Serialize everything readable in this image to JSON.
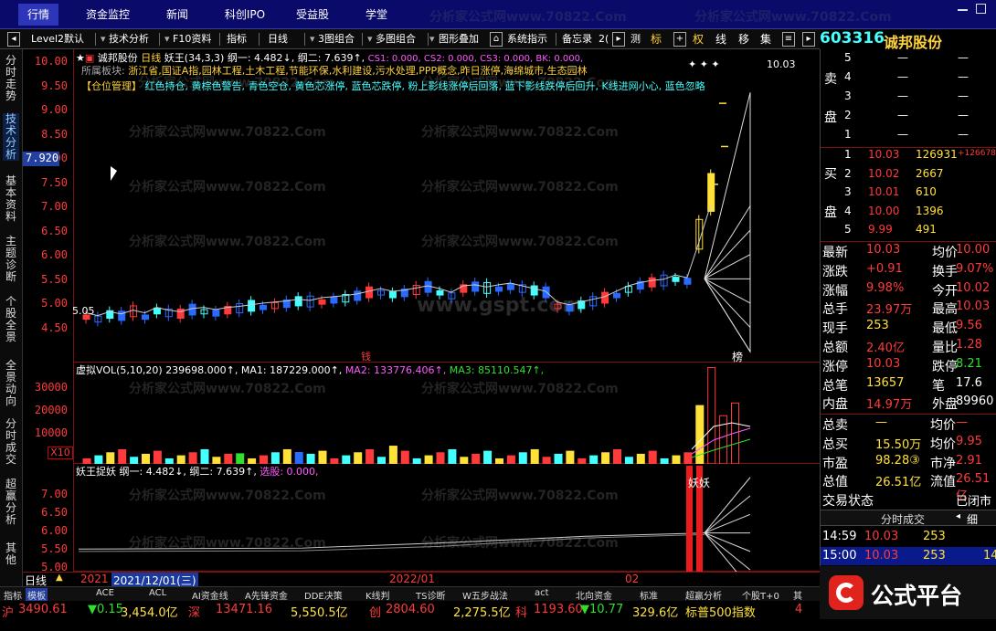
{
  "top_tabs": [
    "行情",
    "资金监控",
    "新闻",
    "科创IPO",
    "受益股",
    "学堂"
  ],
  "toolbar": {
    "items": [
      "Level2默认",
      "技术分析",
      "F10资料",
      "指标",
      "日线",
      "3图组合",
      "多图组合",
      "图形叠加",
      "系统指示",
      "备忘录"
    ],
    "right_items": [
      "测",
      "标",
      "⊞",
      "权",
      "线",
      "移",
      "集"
    ],
    "page_tail": "2("
  },
  "stock": {
    "code": "603316",
    "name": "诚邦股份"
  },
  "side_tabs": [
    "分时走势",
    "技术分析",
    "基本资料",
    "主题诊断",
    "个股全景",
    "全景动向",
    "分时成交",
    "超赢分析",
    "其他"
  ],
  "crosshair_value": "7.920",
  "main_chart": {
    "title": "诚邦股份",
    "period": "日线",
    "ind_name": "妖王(34,3,3)",
    "ind_vals": "纲一: 4.482↓, 纲二: 7.639↑,",
    "cs": "CS1: 0.000,  CS2: 0.000,  CS3: 0.000,  BK: 0.000,",
    "sector_label": "所属板块:",
    "sectors": "浙江省,国证A指,园林工程,土木工程,节能环保,水利建设,污水处理,PPP概念,昨日涨停,海绵城市,生态园林",
    "position_label": "【仓位管理】",
    "position_text": "红色持仓, 黄棕色警告, 青色空仓, 黄色芯涨停, 蓝色芯跌停, 粉上影线涨停后回落, 蓝下影线跌停后回升, K线进网小心, 蓝色忽略",
    "yticks": [
      "10.00",
      "9.50",
      "9.00",
      "8.50",
      "8.00",
      "7.50",
      "7.00",
      "6.50",
      "6.00",
      "5.50",
      "5.00",
      "4.50"
    ],
    "low_label": "5.05",
    "high_label": "10.03",
    "mark_top": "✦ ✦ ✦",
    "mark_bang": "榜",
    "mark_qian": "钱"
  },
  "vol_chart": {
    "title": "虚拟VOL(5,10,20)",
    "v": "239698.000↑,",
    "ma1": "MA1: 187229.000↑,",
    "ma2": "MA2: 133776.406↑,",
    "ma3": "MA3: 85110.547↑,",
    "yticks": [
      "30000",
      "20000",
      "10000"
    ],
    "unit": "X10"
  },
  "ind_chart": {
    "title": "妖王捉妖",
    "v1": "纲一: 4.482↓,",
    "v2": "纲二: 7.639↑,",
    "v3": "选股: 0.000,",
    "yticks": [
      "7.00",
      "6.50",
      "6.00",
      "5.50",
      "5.00"
    ],
    "signal": "妖妖"
  },
  "date_axis": {
    "period": "日线",
    "labels": [
      "2021",
      "2021/12/01(三)",
      "2022/01",
      "02"
    ]
  },
  "watermarks": [
    "分析家公式网www.70822.Com",
    "www.gspt.com"
  ],
  "bottom_nav": [
    "指标",
    "模板",
    "ACE",
    "ACL",
    "AI资金线",
    "A先锋资金",
    "DDE决策",
    "K线判",
    "TS诊断",
    "W五步战法",
    "act",
    "北向资金",
    "标准",
    "超赢分析",
    "个股T+0",
    "其"
  ],
  "ticker": [
    {
      "label": "沪",
      "v": "3490.61",
      "c": "▼0.15",
      "a": "3,454.0亿"
    },
    {
      "label": "深",
      "v": "13471.16",
      "c": "",
      "a": "5,550.5亿"
    },
    {
      "label": "创",
      "v": "2804.60",
      "c": "",
      "a": "2,275.5亿"
    },
    {
      "label": "科",
      "v": "1193.60",
      "c": "▼10.77",
      "a": "329.6亿"
    },
    {
      "label": "标普500指数",
      "v": "4"
    }
  ],
  "order_book": {
    "sell_label": [
      "卖",
      "盘"
    ],
    "buy_label": [
      "买",
      "盘"
    ],
    "sells": [
      {
        "lvl": "5",
        "p": "—",
        "v": "—"
      },
      {
        "lvl": "4",
        "p": "—",
        "v": "—"
      },
      {
        "lvl": "3",
        "p": "—",
        "v": "—"
      },
      {
        "lvl": "2",
        "p": "—",
        "v": "—"
      },
      {
        "lvl": "1",
        "p": "—",
        "v": "—"
      }
    ],
    "buys": [
      {
        "lvl": "1",
        "p": "10.03",
        "v": "126931",
        "d": "+126678"
      },
      {
        "lvl": "2",
        "p": "10.02",
        "v": "2667"
      },
      {
        "lvl": "3",
        "p": "10.01",
        "v": "610"
      },
      {
        "lvl": "4",
        "p": "10.00",
        "v": "1396"
      },
      {
        "lvl": "5",
        "p": "9.99",
        "v": "491"
      }
    ]
  },
  "quote": [
    [
      "最新",
      "10.03",
      "均价",
      "10.00"
    ],
    [
      "涨跌",
      "+0.91",
      "换手",
      "9.07%"
    ],
    [
      "涨幅",
      "9.98%",
      "今开",
      "10.02"
    ],
    [
      "总手",
      "23.97万",
      "最高",
      "10.03"
    ],
    [
      "现手",
      "253",
      "最低",
      "9.56"
    ],
    [
      "总额",
      "2.40亿",
      "量比",
      "1.28"
    ],
    [
      "涨停",
      "10.03",
      "跌停",
      "8.21"
    ],
    [
      "总笔",
      "13657",
      "笔",
      "17.6"
    ],
    [
      "内盘",
      "14.97万",
      "外盘",
      "89960"
    ]
  ],
  "quote2": [
    [
      "总卖",
      "—",
      "均价",
      "—"
    ],
    [
      "总买",
      "15.50万",
      "均价",
      "9.95"
    ],
    [
      "市盈",
      "98.28③",
      "市净",
      "2.91"
    ],
    [
      "总值",
      "26.51亿",
      "流值",
      "26.51亿"
    ],
    [
      "交易状态",
      "",
      "",
      "已闭市"
    ]
  ],
  "ticks_title": "分时成交",
  "ticks_btn": "细",
  "ticks": [
    {
      "t": "14:59",
      "p": "10.03",
      "v": "253"
    },
    {
      "t": "15:00",
      "p": "10.03",
      "v": "253",
      "x": "14"
    }
  ],
  "logo": "公式平台"
}
